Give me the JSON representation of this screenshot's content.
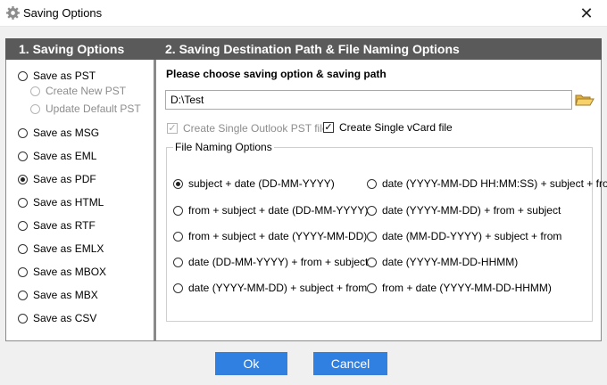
{
  "window": {
    "title": "Saving Options",
    "close_glyph": "✕"
  },
  "left": {
    "header": "1. Saving Options",
    "options": [
      {
        "label": "Save as PST",
        "checked": false,
        "disabled": false
      },
      {
        "label": "Create New PST",
        "checked": false,
        "disabled": true
      },
      {
        "label": "Update Default PST",
        "checked": false,
        "disabled": true
      },
      {
        "label": "Save as MSG",
        "checked": false,
        "disabled": false
      },
      {
        "label": "Save as EML",
        "checked": false,
        "disabled": false
      },
      {
        "label": "Save as PDF",
        "checked": true,
        "disabled": false
      },
      {
        "label": "Save as HTML",
        "checked": false,
        "disabled": false
      },
      {
        "label": "Save as RTF",
        "checked": false,
        "disabled": false
      },
      {
        "label": "Save as EMLX",
        "checked": false,
        "disabled": false
      },
      {
        "label": "Save as MBOX",
        "checked": false,
        "disabled": false
      },
      {
        "label": "Save as MBX",
        "checked": false,
        "disabled": false
      },
      {
        "label": "Save as CSV",
        "checked": false,
        "disabled": false
      }
    ]
  },
  "right": {
    "header": "2. Saving Destination Path & File Naming Options",
    "prompt": "Please choose saving option & saving path",
    "path_value": "D:\\Test",
    "checkboxes": [
      {
        "label": "Create Single Outlook PST file",
        "checked": true,
        "disabled": true
      },
      {
        "label": "Create Single vCard file",
        "checked": true,
        "disabled": false
      }
    ],
    "naming_group": {
      "legend": "File Naming Options",
      "options": [
        {
          "label": "subject + date (DD-MM-YYYY)",
          "checked": true
        },
        {
          "label": "date (YYYY-MM-DD HH:MM:SS) + subject + from",
          "checked": false
        },
        {
          "label": "from + subject + date (DD-MM-YYYY)",
          "checked": false
        },
        {
          "label": "date (YYYY-MM-DD) + from + subject",
          "checked": false
        },
        {
          "label": "from + subject + date (YYYY-MM-DD)",
          "checked": false
        },
        {
          "label": "date (MM-DD-YYYY) + subject + from",
          "checked": false
        },
        {
          "label": "date (DD-MM-YYYY) + from + subject",
          "checked": false
        },
        {
          "label": "date (YYYY-MM-DD-HHMM)",
          "checked": false
        },
        {
          "label": "date (YYYY-MM-DD) + subject + from",
          "checked": false
        },
        {
          "label": "from + date (YYYY-MM-DD-HHMM)",
          "checked": false
        }
      ]
    }
  },
  "footer": {
    "ok_label": "Ok",
    "cancel_label": "Cancel"
  },
  "colors": {
    "header_bg": "#5a5a5a",
    "button_bg": "#2f80e0",
    "panel_border": "#8a8a8a"
  }
}
